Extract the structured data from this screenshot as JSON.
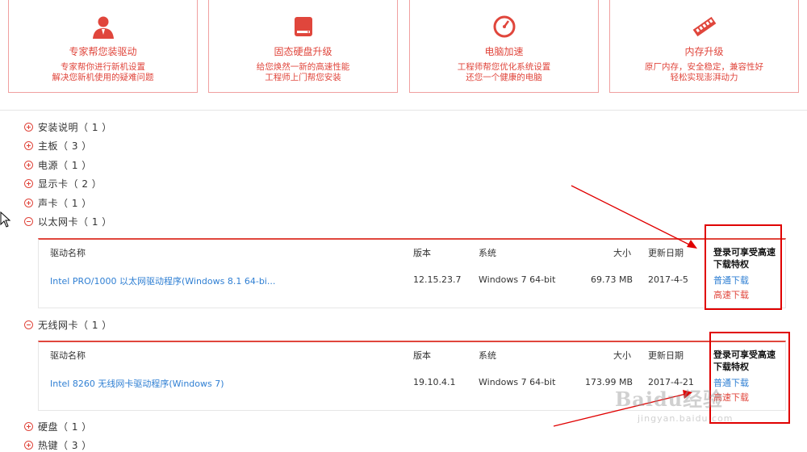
{
  "service_cards": [
    {
      "icon": "person-icon",
      "title": "专家帮您装驱动",
      "line1": "专家帮你进行新机设置",
      "line2": "解决您新机使用的疑难问题"
    },
    {
      "icon": "hard-drive-icon",
      "title": "固态硬盘升级",
      "line1": "给您焕然一新的高速性能",
      "line2": "工程师上门帮您安装"
    },
    {
      "icon": "speedometer-icon",
      "title": "电脑加速",
      "line1": "工程师帮您优化系统设置",
      "line2": "还您一个健康的电脑"
    },
    {
      "icon": "memory-icon",
      "title": "内存升级",
      "line1": "原厂内存，安全稳定，兼容性好",
      "line2": "轻松实现澎湃动力"
    }
  ],
  "categories": [
    {
      "label": "安装说明（ 1 ）",
      "state": "collapsed"
    },
    {
      "label": "主板（ 3 ）",
      "state": "collapsed"
    },
    {
      "label": "电源（ 1 ）",
      "state": "collapsed"
    },
    {
      "label": "显示卡（ 2 ）",
      "state": "collapsed"
    },
    {
      "label": "声卡（ 1 ）",
      "state": "collapsed"
    },
    {
      "label": "以太网卡（ 1 ）",
      "state": "expanded"
    },
    {
      "label": "无线网卡（ 1 ）",
      "state": "expanded"
    },
    {
      "label": "硬盘（ 1 ）",
      "state": "collapsed"
    },
    {
      "label": "热键（ 3 ）",
      "state": "collapsed"
    }
  ],
  "table_headers": {
    "name": "驱动名称",
    "version": "版本",
    "system": "系统",
    "size": "大小",
    "date": "更新日期",
    "perk": "登录可享受高速下载特权"
  },
  "drivers": [
    {
      "name": "Intel PRO/1000 以太网驱动程序(Windows 8.1 64-bi...",
      "version": "12.15.23.7",
      "system": "Windows 7 64-bit",
      "size": "69.73 MB",
      "date": "2017-4-5",
      "normal_download": "普通下载",
      "fast_download": "高速下载"
    },
    {
      "name": "Intel 8260 无线网卡驱动程序(Windows 7)",
      "version": "19.10.4.1",
      "system": "Windows 7 64-bit",
      "size": "173.99 MB",
      "date": "2017-4-21",
      "normal_download": "普通下载",
      "fast_download": "高速下载"
    }
  ],
  "watermark": {
    "brand": "Baidu经验",
    "url": "jingyan.baidu.com"
  },
  "colors": {
    "accent": "#e0463c",
    "link": "#2f7fd3",
    "highlight": "#e00000"
  }
}
